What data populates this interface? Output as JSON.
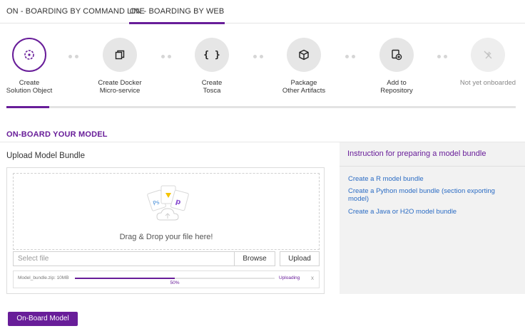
{
  "tabs": [
    {
      "label": "ON - BOARDING BY COMMAND LINE"
    },
    {
      "label": "ON - BOARDING BY WEB"
    }
  ],
  "steps": [
    {
      "label": "Create\nSolution Object",
      "icon": "solution-object-icon"
    },
    {
      "label": "Create Docker\nMicro-service",
      "icon": "docker-copy-icon"
    },
    {
      "label": "Create\nTosca",
      "icon": "braces-icon"
    },
    {
      "label": "Package\nOther Artifacts",
      "icon": "package-cube-icon"
    },
    {
      "label": "Add to\nRepository",
      "icon": "repository-add-icon"
    },
    {
      "label": "Not yet onboarded",
      "icon": "not-onboarded-icon"
    }
  ],
  "section_title": "ON-BOARD YOUR MODEL",
  "upload": {
    "title": "Upload Model Bundle",
    "drop_text": "Drag & Drop your file here!",
    "file_placeholder": "Select file",
    "browse_label": "Browse",
    "upload_label": "Upload",
    "progress_file": "Model_bundle.zip: 10MB",
    "progress_value": 0.5,
    "progress_percent": "50%",
    "progress_status": "Uploading",
    "close_label": "x"
  },
  "instructions": {
    "title": "Instruction for preparing a model bundle",
    "links": [
      "Create a R model bundle",
      "Create a Python model bundle (section exporting model)",
      "Create a Java or H2O model bundle"
    ]
  },
  "onboard_button": "On-Board Model",
  "colors": {
    "accent": "#681d99",
    "link": "#2b6cc4"
  }
}
